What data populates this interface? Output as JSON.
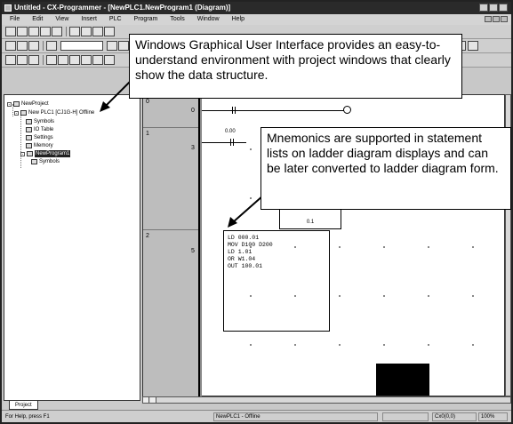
{
  "window": {
    "title": "Untitled - CX-Programmer - [NewPLC1.NewProgram1 (Diagram)]"
  },
  "menu": [
    "File",
    "Edit",
    "View",
    "Insert",
    "PLC",
    "Program",
    "Tools",
    "Window",
    "Help"
  ],
  "project_tree": {
    "root": "NewProject",
    "plc": "New PLC1 [CJ1G-H] Offline",
    "items": [
      "Symbols",
      "IO Table",
      "Settings",
      "Memory"
    ],
    "program": "NewProgram1",
    "program_items": [
      "Symbols"
    ],
    "tab": "Project"
  },
  "ladder": {
    "rungs": [
      {
        "index": "0",
        "step": "0"
      },
      {
        "index": "1",
        "step": "3"
      },
      {
        "index": "2",
        "step": "5"
      }
    ],
    "contact_label": "0.00",
    "fbox_label": "0.1"
  },
  "statement_list": [
    "LD 000.01",
    "MOV D100 D200",
    "LD 1.01",
    "OR W1.04",
    "OUT 100.01"
  ],
  "callouts": {
    "gui": "Windows Graphical User Interface provides an easy-to-understand environment with project windows that clearly show the data structure.",
    "mnemonics": "Mnemonics are supported in statement lists on ladder diagram displays and can be later converted to ladder diagram form."
  },
  "status": {
    "help": "For Help, press F1",
    "plc_state": "NewPLC1 - Offline",
    "position": "Cx0(0,0)",
    "zoom": "100%"
  }
}
